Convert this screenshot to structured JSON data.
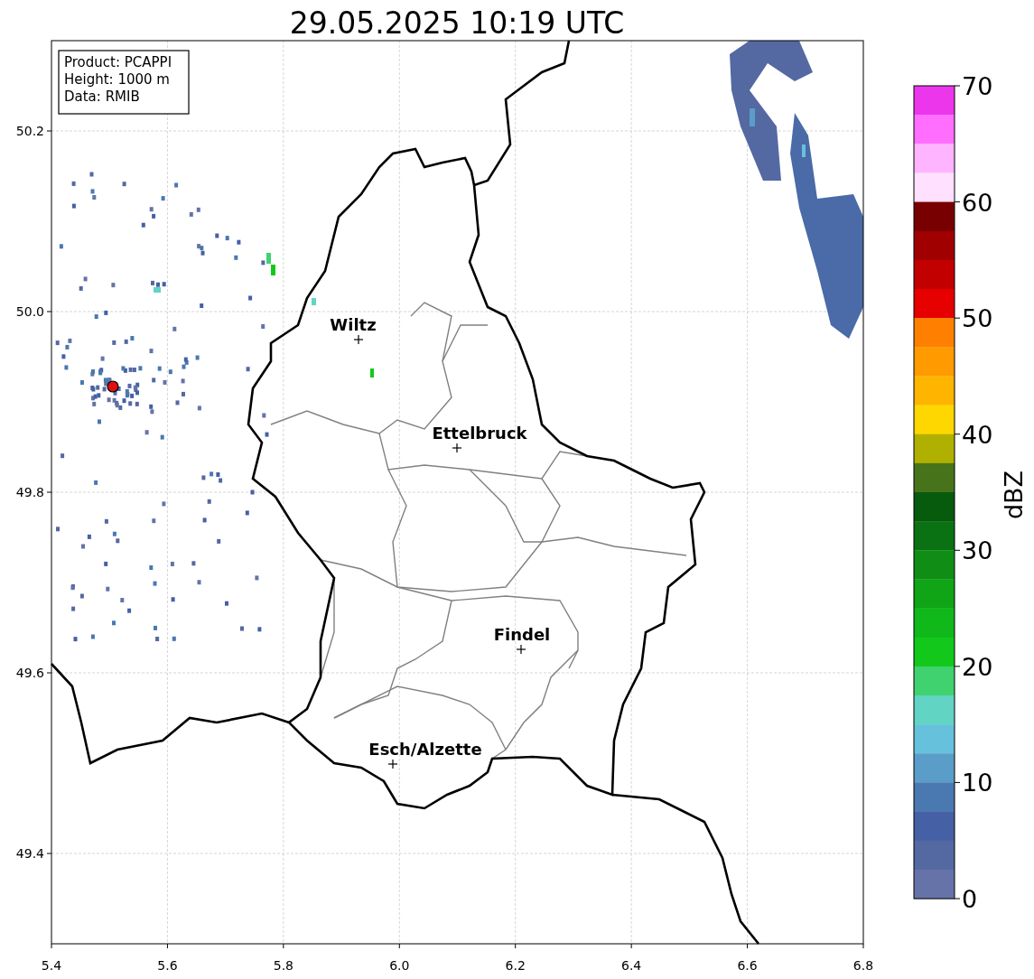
{
  "title": "29.05.2025 10:19 UTC",
  "info_box": [
    "Product: PCAPPI",
    "Height: 1000 m",
    "Data: RMIB"
  ],
  "map": {
    "places": [
      "Wiltz",
      "Ettelbruck",
      "Findel",
      "Esch/Alzette"
    ],
    "x_ticks": [
      "5.4",
      "5.6",
      "5.8",
      "6.0",
      "6.2",
      "6.4",
      "6.6",
      "6.8"
    ],
    "y_ticks": [
      "50.2",
      "50.0",
      "49.8",
      "49.6",
      "49.4"
    ]
  },
  "colorbar": {
    "label": "dBZ",
    "ticks": [
      "70",
      "60",
      "50",
      "40",
      "30",
      "20",
      "10",
      "0"
    ],
    "colors": [
      {
        "color": "#ec36ec"
      },
      {
        "color": "#ff6eff"
      },
      {
        "color": "#ffb4ff"
      },
      {
        "color": "#ffe0ff"
      },
      {
        "color": "#780000"
      },
      {
        "color": "#a00000"
      },
      {
        "color": "#c20000"
      },
      {
        "color": "#e60000"
      },
      {
        "color": "#ff7f00"
      },
      {
        "color": "#ff9a00"
      },
      {
        "color": "#ffb400"
      },
      {
        "color": "#ffd700"
      },
      {
        "color": "#b0b000"
      },
      {
        "color": "#47741a"
      },
      {
        "color": "#075b0d"
      },
      {
        "color": "#0a7212"
      },
      {
        "color": "#0f8d15"
      },
      {
        "color": "#0fa516"
      },
      {
        "color": "#10b81a"
      },
      {
        "color": "#12c91b"
      },
      {
        "color": "#3fd26f"
      },
      {
        "color": "#62d4c4"
      },
      {
        "color": "#66c1dc"
      },
      {
        "color": "#5a9dc8"
      },
      {
        "color": "#4a78b0"
      },
      {
        "color": "#4560a5"
      },
      {
        "color": "#5468a2"
      },
      {
        "color": "#6673a8"
      }
    ]
  }
}
